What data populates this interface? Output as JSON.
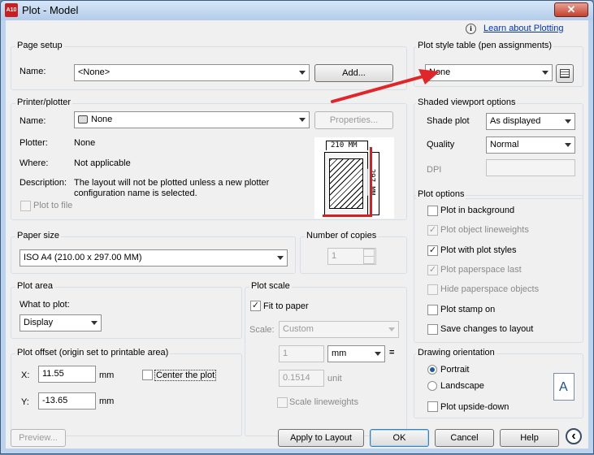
{
  "window": {
    "title": "Plot - Model",
    "logo_text": "A10",
    "close_glyph": "✕"
  },
  "help_link": "Learn about Plotting",
  "page_setup": {
    "label": "Page setup",
    "name_label": "Name:",
    "name_value": "<None>",
    "add_button": "Add..."
  },
  "printer": {
    "label": "Printer/plotter",
    "name_label": "Name:",
    "name_value": "None",
    "properties_button": "Properties...",
    "plotter_label": "Plotter:",
    "plotter_value": "None",
    "where_label": "Where:",
    "where_value": "Not applicable",
    "description_label": "Description:",
    "description_line1": "The layout will not be plotted unless a new plotter",
    "description_line2": "configuration name is selected.",
    "plot_to_file": "Plot to file",
    "preview_width": "210  MM",
    "preview_height": "297  MM"
  },
  "paper_size": {
    "label": "Paper size",
    "value": "ISO A4 (210.00 x 297.00 MM)"
  },
  "copies": {
    "label": "Number of copies",
    "value": "1"
  },
  "plot_area": {
    "label": "Plot area",
    "what_label": "What to plot:",
    "what_value": "Display"
  },
  "plot_offset": {
    "label": "Plot offset (origin set to printable area)",
    "x_label": "X:",
    "x_value": "11.55",
    "x_unit": "mm",
    "y_label": "Y:",
    "y_value": "-13.65",
    "y_unit": "mm",
    "center_label": "Center the plot"
  },
  "plot_scale": {
    "label": "Plot scale",
    "fit_label": "Fit to paper",
    "scale_label": "Scale:",
    "scale_value": "Custom",
    "value1": "1",
    "unit1": "mm",
    "equals": "=",
    "value2": "0.1514",
    "unit2": "unit",
    "lineweights_label": "Scale lineweights"
  },
  "plot_style_table": {
    "label": "Plot style table (pen assignments)",
    "value": "None"
  },
  "shaded_viewport": {
    "label": "Shaded viewport options",
    "shade_label": "Shade plot",
    "shade_value": "As displayed",
    "quality_label": "Quality",
    "quality_value": "Normal",
    "dpi_label": "DPI"
  },
  "plot_options": {
    "label": "Plot options",
    "items": [
      {
        "label": "Plot in background",
        "checked": false,
        "enabled": true
      },
      {
        "label": "Plot object lineweights",
        "checked": true,
        "enabled": false
      },
      {
        "label": "Plot with plot styles",
        "checked": true,
        "enabled": true
      },
      {
        "label": "Plot paperspace last",
        "checked": true,
        "enabled": false
      },
      {
        "label": "Hide paperspace objects",
        "checked": false,
        "enabled": false
      },
      {
        "label": "Plot stamp on",
        "checked": false,
        "enabled": true
      },
      {
        "label": "Save changes to layout",
        "checked": false,
        "enabled": true
      }
    ]
  },
  "orientation": {
    "label": "Drawing orientation",
    "portrait": "Portrait",
    "landscape": "Landscape",
    "upside_down": "Plot upside-down",
    "icon_letter": "A"
  },
  "buttons": {
    "preview": "Preview...",
    "apply": "Apply to Layout",
    "ok": "OK",
    "cancel": "Cancel",
    "help": "Help",
    "expand_glyph": "‹"
  },
  "colors": {
    "annotation_arrow": "#e0262b",
    "paper_border": "#d42020"
  }
}
